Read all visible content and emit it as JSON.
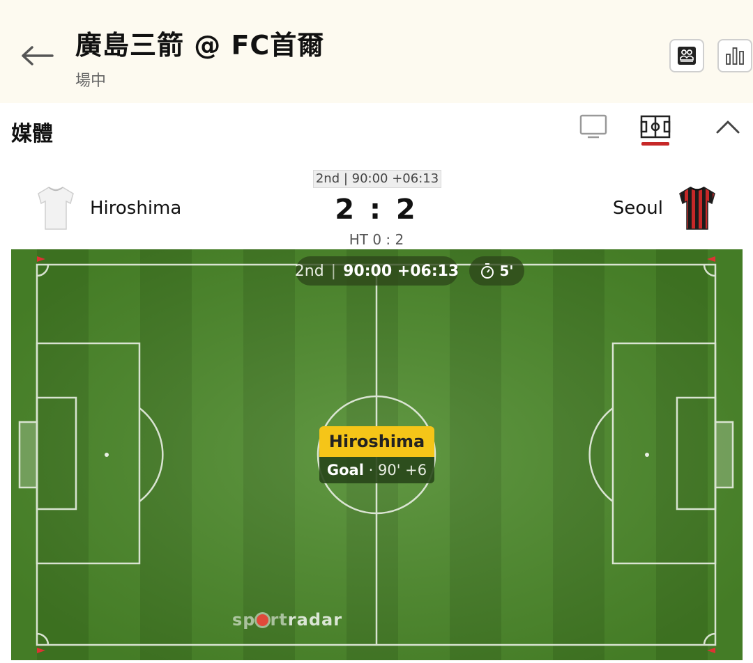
{
  "header": {
    "title": "廣島三箭 @ FC首爾",
    "status": "場中"
  },
  "media": {
    "label": "媒體"
  },
  "match": {
    "clock_badge": "2nd | 90:00 +06:13",
    "home": {
      "name": "Hiroshima",
      "shirt_color": "#f2f2f2"
    },
    "away": {
      "name": "Seoul",
      "shirt_color": "#c62828"
    },
    "score": "2 : 2",
    "halftime": "HT 0 : 2"
  },
  "pitch": {
    "period": "2nd",
    "time": "90:00 +06:13",
    "timer_label": "5'",
    "event": {
      "team": "Hiroshima",
      "type": "Goal",
      "minute": "· 90' +6"
    },
    "brand": {
      "part1": "sp",
      "part2": "rt",
      "part3": "radar"
    }
  },
  "colors": {
    "accent_red": "#c62828",
    "event_yellow": "#f5c518",
    "pitch_green": "#4f8a2c"
  }
}
